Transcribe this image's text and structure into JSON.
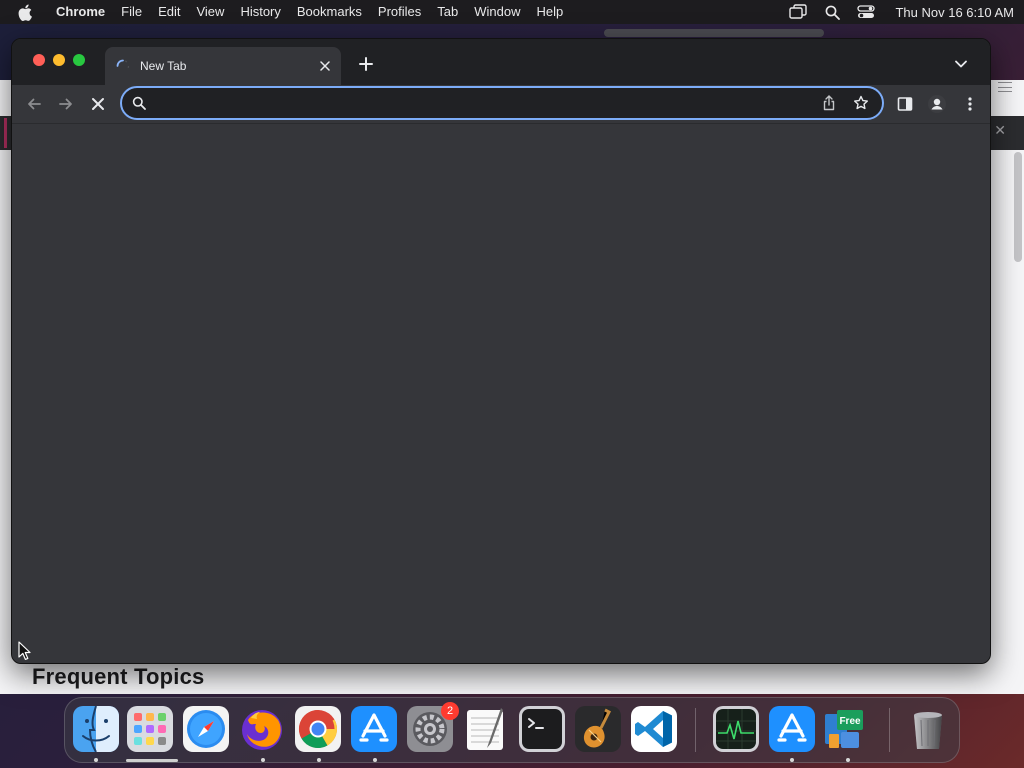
{
  "menubar": {
    "app_name": "Chrome",
    "items": [
      "File",
      "Edit",
      "View",
      "History",
      "Bookmarks",
      "Profiles",
      "Tab",
      "Window",
      "Help"
    ],
    "clock": "Thu Nov 16  6:10 AM",
    "status_icons": [
      "screen-mirroring-icon",
      "spotlight-search-icon",
      "control-center-icon"
    ]
  },
  "browser": {
    "tab": {
      "title": "New Tab",
      "loading": true
    },
    "omnibox": {
      "value": "",
      "placeholder": ""
    },
    "colors": {
      "accent": "#7cacf8",
      "frame": "#202124",
      "toolbar": "#35363a"
    }
  },
  "background_window": {
    "heading": "Frequent Topics"
  },
  "dock": {
    "apps": [
      {
        "name": "Finder",
        "running": true
      },
      {
        "name": "Launchpad",
        "running": false
      },
      {
        "name": "Safari",
        "running": false
      },
      {
        "name": "Firefox",
        "running": true
      },
      {
        "name": "Google Chrome",
        "running": true
      },
      {
        "name": "App Store",
        "running": true
      },
      {
        "name": "System Settings",
        "running": false,
        "badge": "2"
      },
      {
        "name": "TextEdit",
        "running": false
      },
      {
        "name": "Terminal",
        "running": false
      },
      {
        "name": "GarageBand",
        "running": false
      },
      {
        "name": "Visual Studio Code",
        "running": false
      },
      {
        "name": "Activity Monitor",
        "running": false
      },
      {
        "name": "App Store",
        "running": true
      },
      {
        "name": "Free App",
        "running": true
      },
      {
        "name": "Trash",
        "running": false
      }
    ]
  }
}
